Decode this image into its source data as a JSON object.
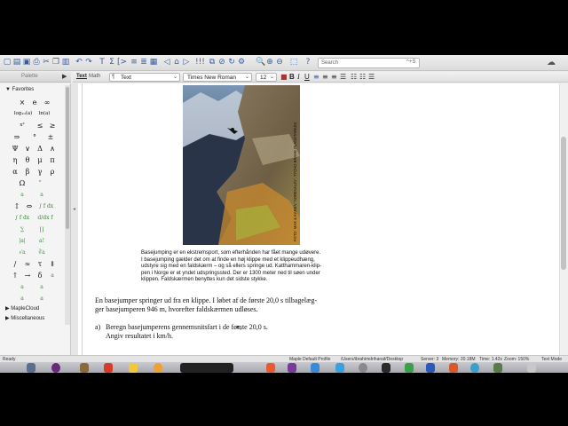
{
  "toolbar": {
    "search_placeholder": "Search",
    "search_shortcut": "^+S"
  },
  "palette_header": {
    "label": "Palette"
  },
  "formatbar": {
    "text_mode": "Text",
    "math_mode": "Math",
    "style_select": "Text",
    "font_select": "Times New Roman",
    "size_select": "12",
    "bold": "B",
    "italic": "I",
    "underline": "U"
  },
  "palette": {
    "favorites": "Favorites",
    "symbols": [
      "×",
      "e",
      "∞",
      "log₁₀(a)",
      "ln(a)",
      "x²",
      "≤",
      "≥",
      "⇒",
      "°",
      "±",
      "Ψ",
      "∨",
      "Δ",
      "∧",
      "η",
      "θ",
      "μ",
      "π",
      "α",
      "β",
      "γ",
      "ρ",
      "Ω",
      "ᵀ",
      "⇔",
      "∫ f dx",
      "∫ f dx",
      "d/dx f",
      "|a|",
      "a!",
      "√a",
      "∛a",
      "/",
      "≈",
      "τ",
      "⇓",
      "↑",
      "→",
      "δ"
    ],
    "maplecloud": "MapleCloud",
    "miscellaneous": "Miscellaneous"
  },
  "document": {
    "photo_credit": "FOTO: MAX & KAREN \"ADRENALIN\", TYCHO BRAHE PLANETARIUM",
    "caption": [
      "Basejumping er en ekstremsport, som efterhånden har fået mange udøvere.",
      "I basejumping gælder det om at finde en høj klippe med et klippeudhæng,",
      "udstyre sig med en faldskærm – og så ellers springe ud. Katthammaren-klip-",
      "pen i Norge er et yndet udspringssted. Der er 1300 meter ned til søen under",
      "klippen. Faldskærmen benyttes kun det sidste stykke."
    ],
    "body": [
      "En basejumper springer ud fra en klippe. I løbet af de første 20,0 s tilbagelæg-",
      "ger basejumperen 946 m, hvorefter faldskærmen udløses."
    ],
    "question_label": "a)",
    "question_line1": "Beregn basejumperens gennemsnitsfart i de første 20,0 s.",
    "question_line2": "Angiv resultatet i km/h."
  },
  "statusbar": {
    "state": "Ready",
    "profile": "Maple Default Profile",
    "path": "/Users/ibrahimdrihanaf/Desktop",
    "server": "Server: 3",
    "memory": "Memory: 20.18M",
    "time": "Time: 1.42s",
    "zoom": "Zoom: 150%",
    "mode": "Text Mode"
  },
  "colors": {
    "accent_blue": "#3a5a9a",
    "palette_green": "#3a8a3a"
  }
}
